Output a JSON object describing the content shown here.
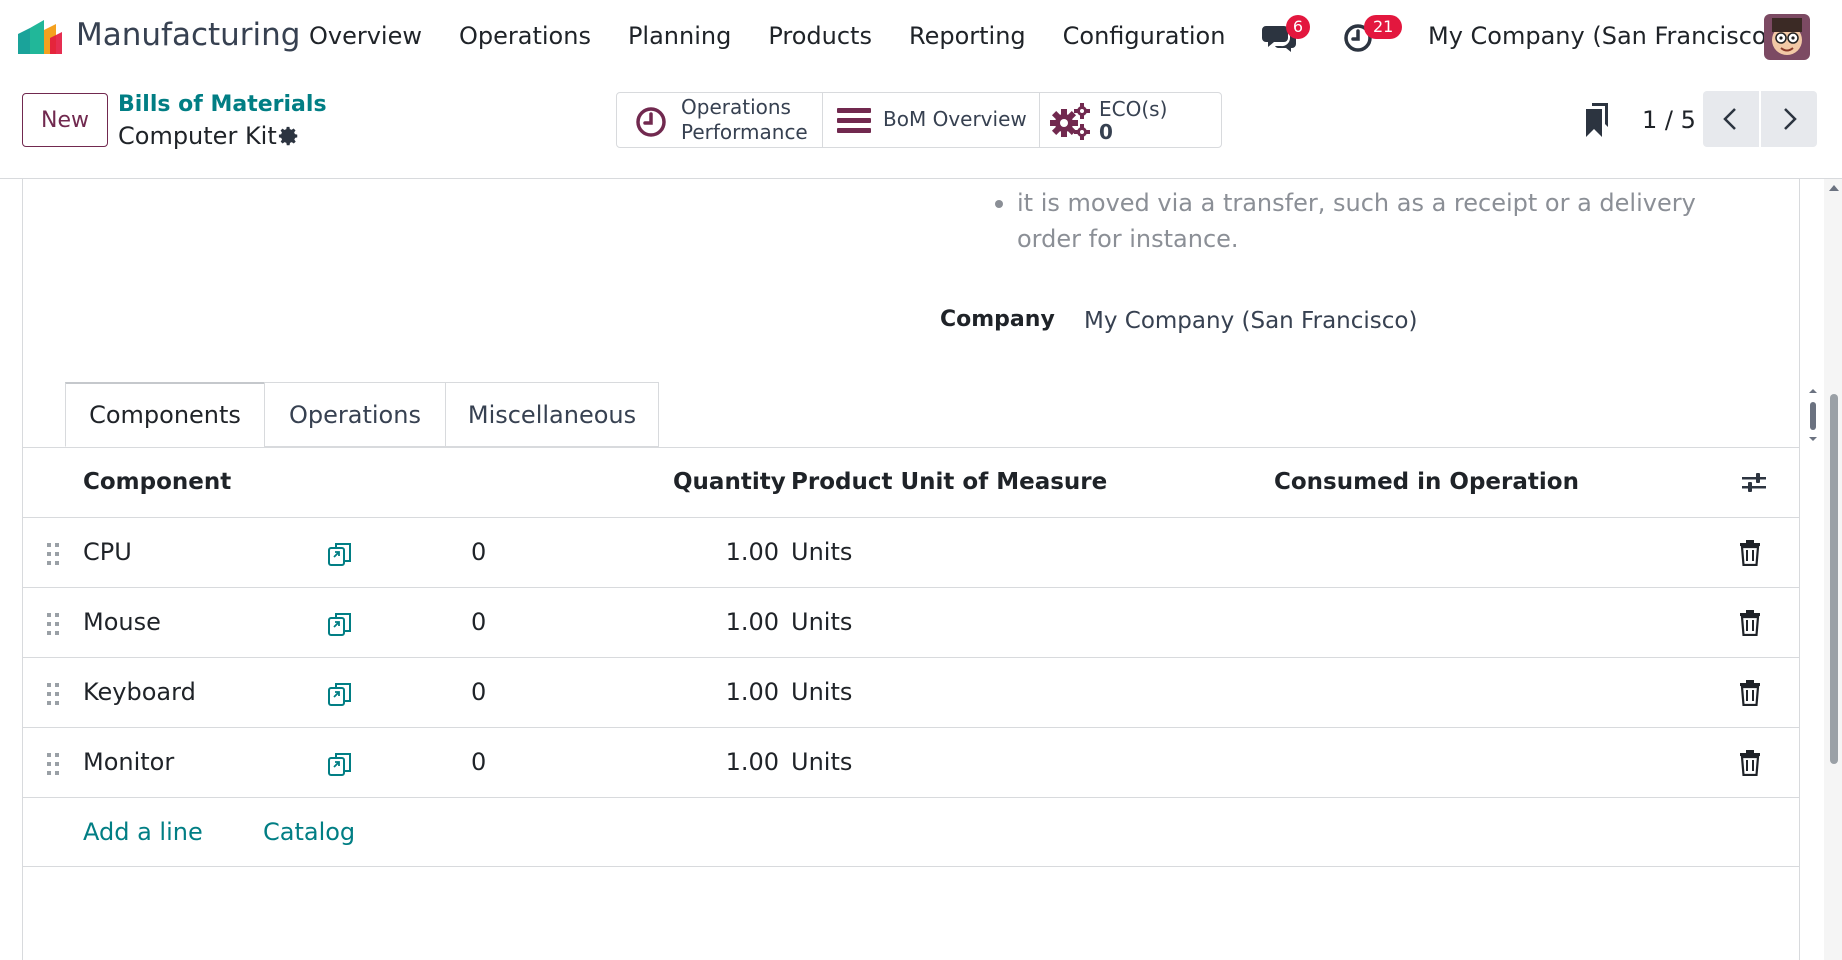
{
  "navbar": {
    "app_name": "Manufacturing",
    "menu": [
      "Overview",
      "Operations",
      "Planning",
      "Products",
      "Reporting",
      "Configuration"
    ],
    "messages_count": "6",
    "activities_count": "21",
    "company": "My Company (San Francisco)",
    "brand_colors": {
      "teal": "#1aa39a",
      "orange": "#f4a11f",
      "red": "#e3173e"
    }
  },
  "control": {
    "new_label": "New",
    "breadcrumb_parent": "Bills of Materials",
    "breadcrumb_current": "Computer Kit",
    "smart_buttons": {
      "ops_line1": "Operations",
      "ops_line2": "Performance",
      "bom_overview": "BoM Overview",
      "eco_label": "ECO(s)",
      "eco_count": "0"
    },
    "pager": "1 / 5"
  },
  "form": {
    "help_text": "it is moved via a transfer, such as a receipt or a delivery order for instance.",
    "company_label": "Company",
    "company_value": "My Company (San Francisco)",
    "tabs": [
      "Components",
      "Operations",
      "Miscellaneous"
    ],
    "columns": {
      "component": "Component",
      "quantity": "Quantity",
      "uom": "Product Unit of Measure",
      "consumed": "Consumed in Operation"
    },
    "rows": [
      {
        "name": "CPU",
        "extra": "0",
        "qty": "1.00",
        "uom": "Units"
      },
      {
        "name": "Mouse",
        "extra": "0",
        "qty": "1.00",
        "uom": "Units"
      },
      {
        "name": "Keyboard",
        "extra": "0",
        "qty": "1.00",
        "uom": "Units"
      },
      {
        "name": "Monitor",
        "extra": "0",
        "qty": "1.00",
        "uom": "Units"
      }
    ],
    "add_line": "Add a line",
    "catalog": "Catalog"
  }
}
